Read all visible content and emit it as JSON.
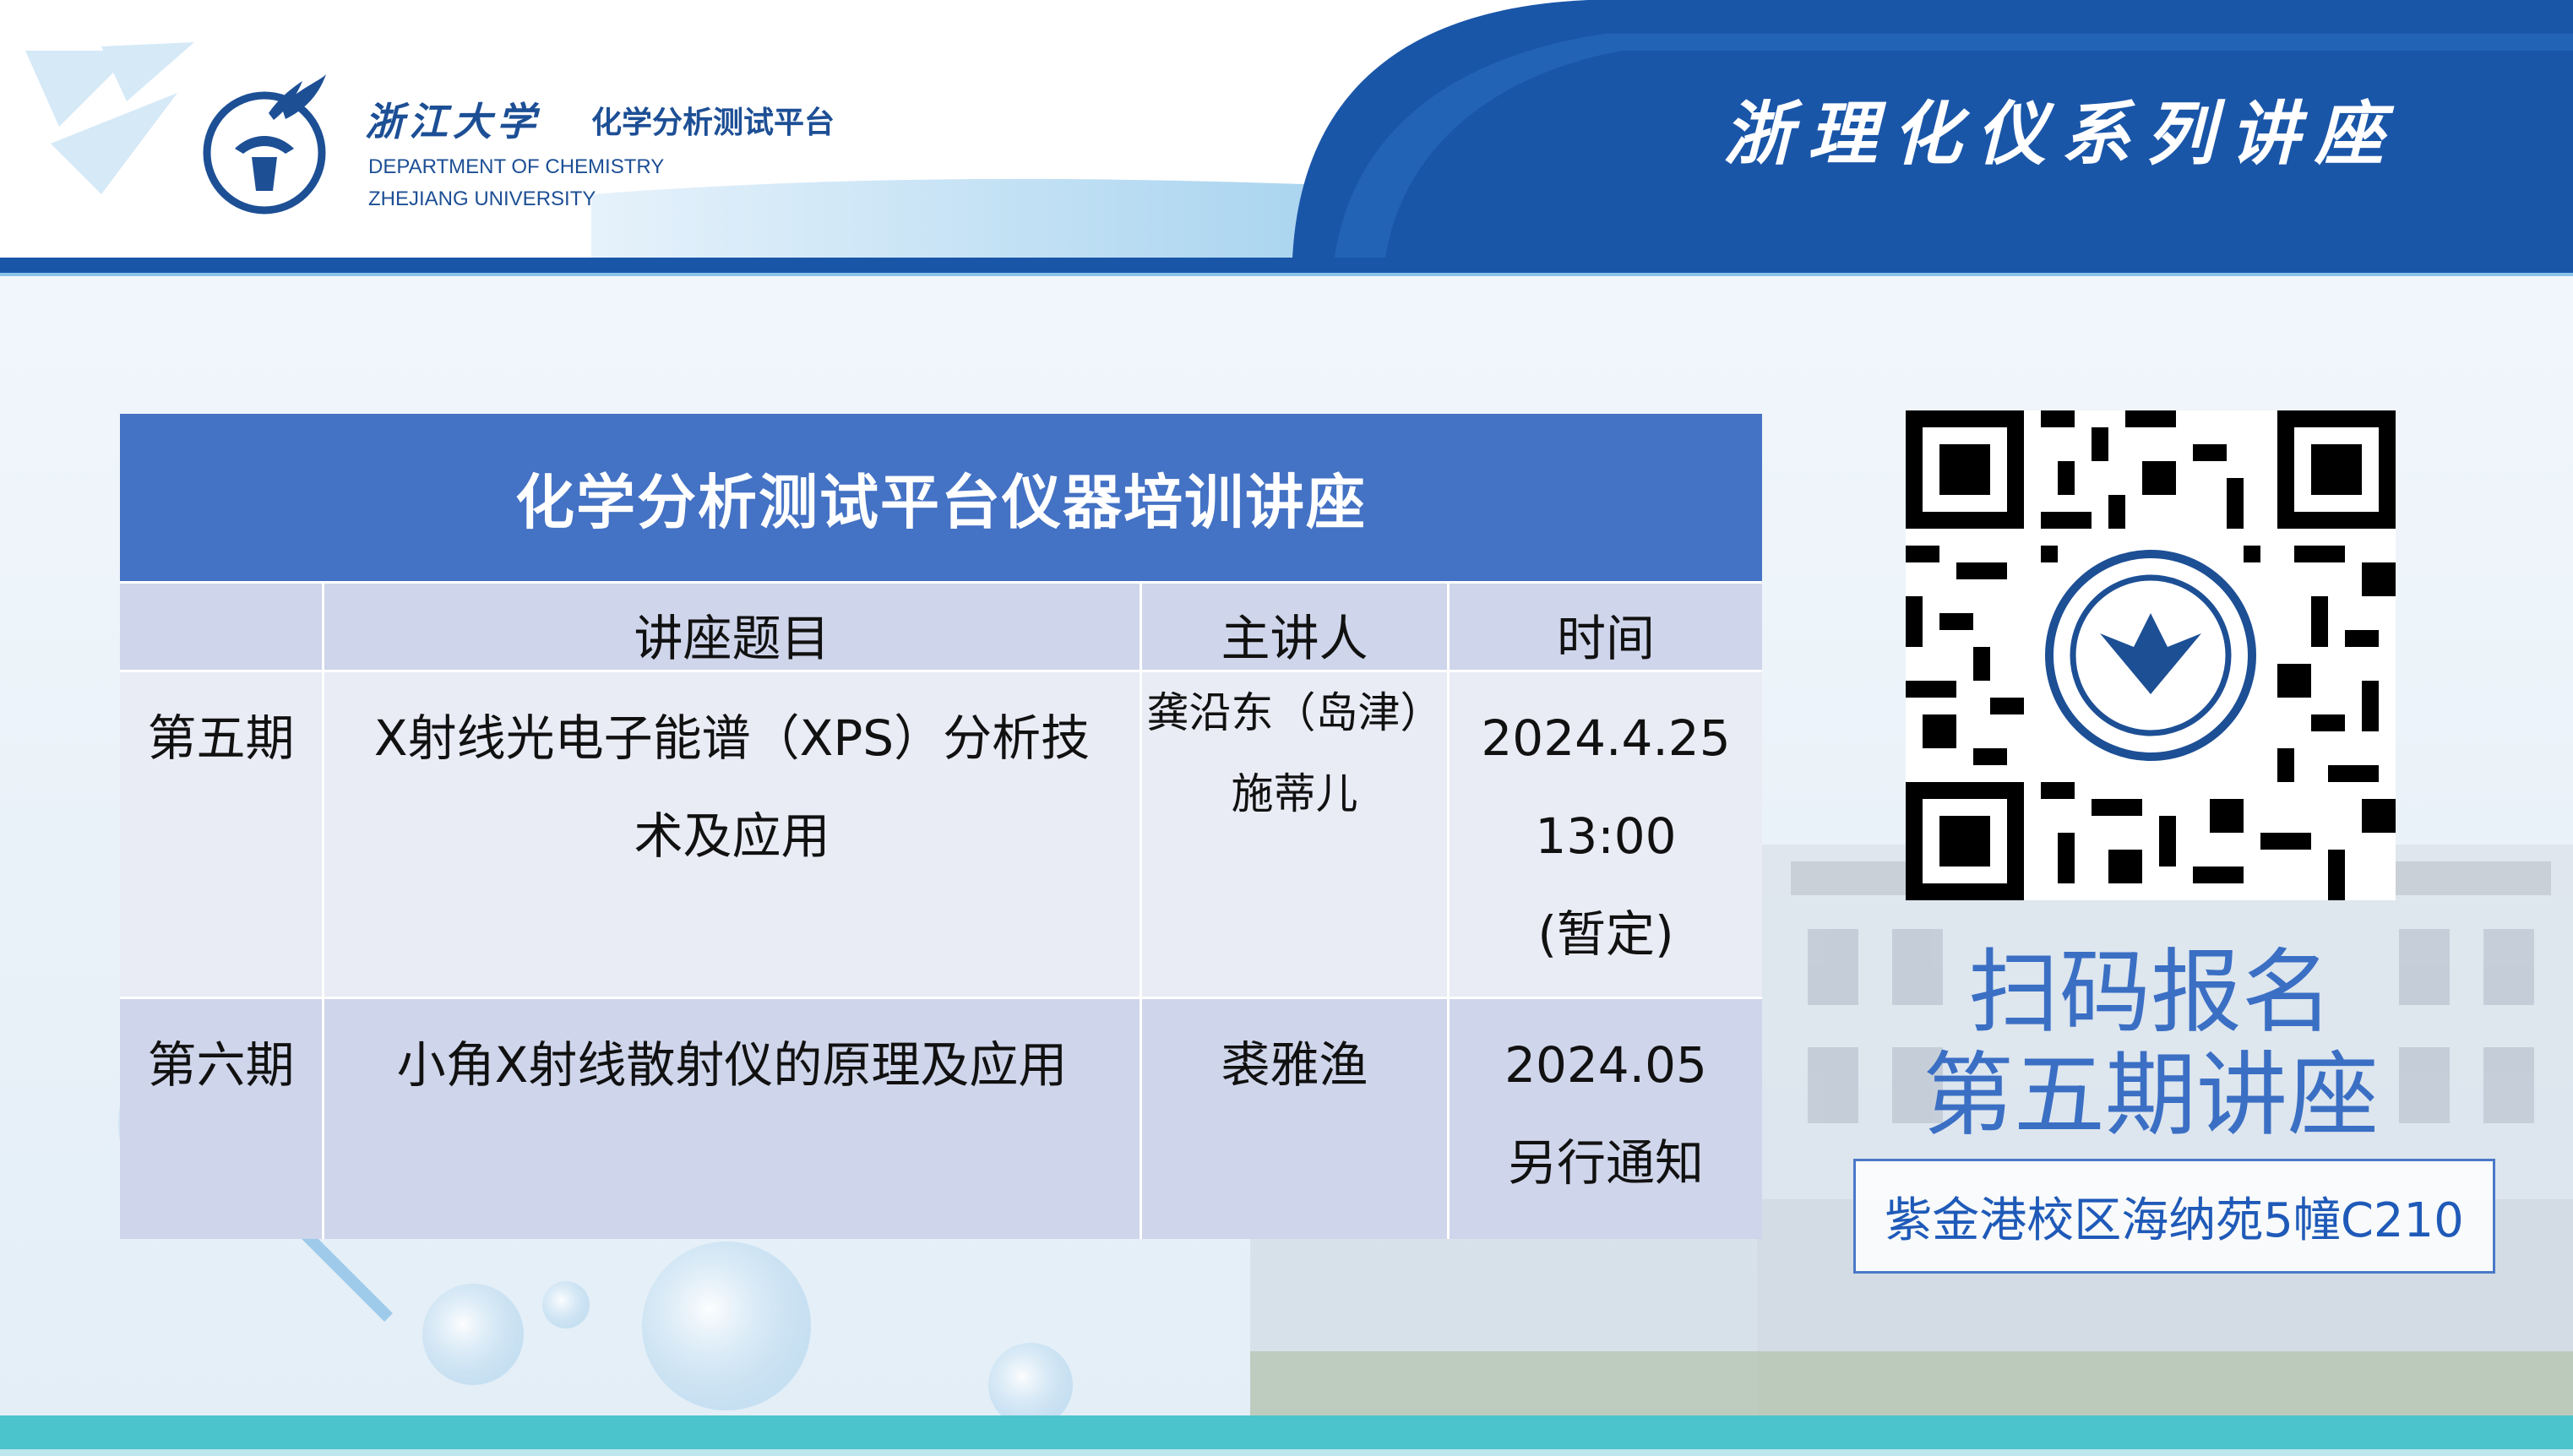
{
  "header": {
    "univ_cn": "浙江大学",
    "platform_cn": "化学分析测试平台",
    "dept_en": "DEPARTMENT OF CHEMISTRY",
    "univ_en": "ZHEJIANG UNIVERSITY",
    "series_title": "浙理化仪系列讲座"
  },
  "table": {
    "title": "化学分析测试平台仪器培训讲座",
    "headers": [
      "",
      "讲座题目",
      "主讲人",
      "时间"
    ],
    "rows": [
      {
        "period": "第五期",
        "topic_line1": "X射线光电子能谱（XPS）分析技",
        "topic_line2": "术及应用",
        "speaker_line1": "龚沿东（岛津）",
        "speaker_line2": "施蒂儿",
        "time_line1": "2024.4.25",
        "time_line2": "13:00",
        "time_line3": "(暂定)"
      },
      {
        "period": "第六期",
        "topic_line1": "小角X射线散射仪的原理及应用",
        "speaker_line1": "裘雅渔",
        "time_line1": "2024.05",
        "time_line2": "另行通知"
      }
    ]
  },
  "qr": {
    "cta_line1": "扫码报名",
    "cta_line2": "第五期讲座"
  },
  "location": "紫金港校区海纳苑5幢C210",
  "colors": {
    "header_blue": "#1a56a8",
    "table_title": "#4472c4",
    "row_dark": "#cfd5ea",
    "row_light": "#e9ebf5",
    "accent_text": "#3a6fc4",
    "bottom_bar": "#4cc4cc"
  }
}
